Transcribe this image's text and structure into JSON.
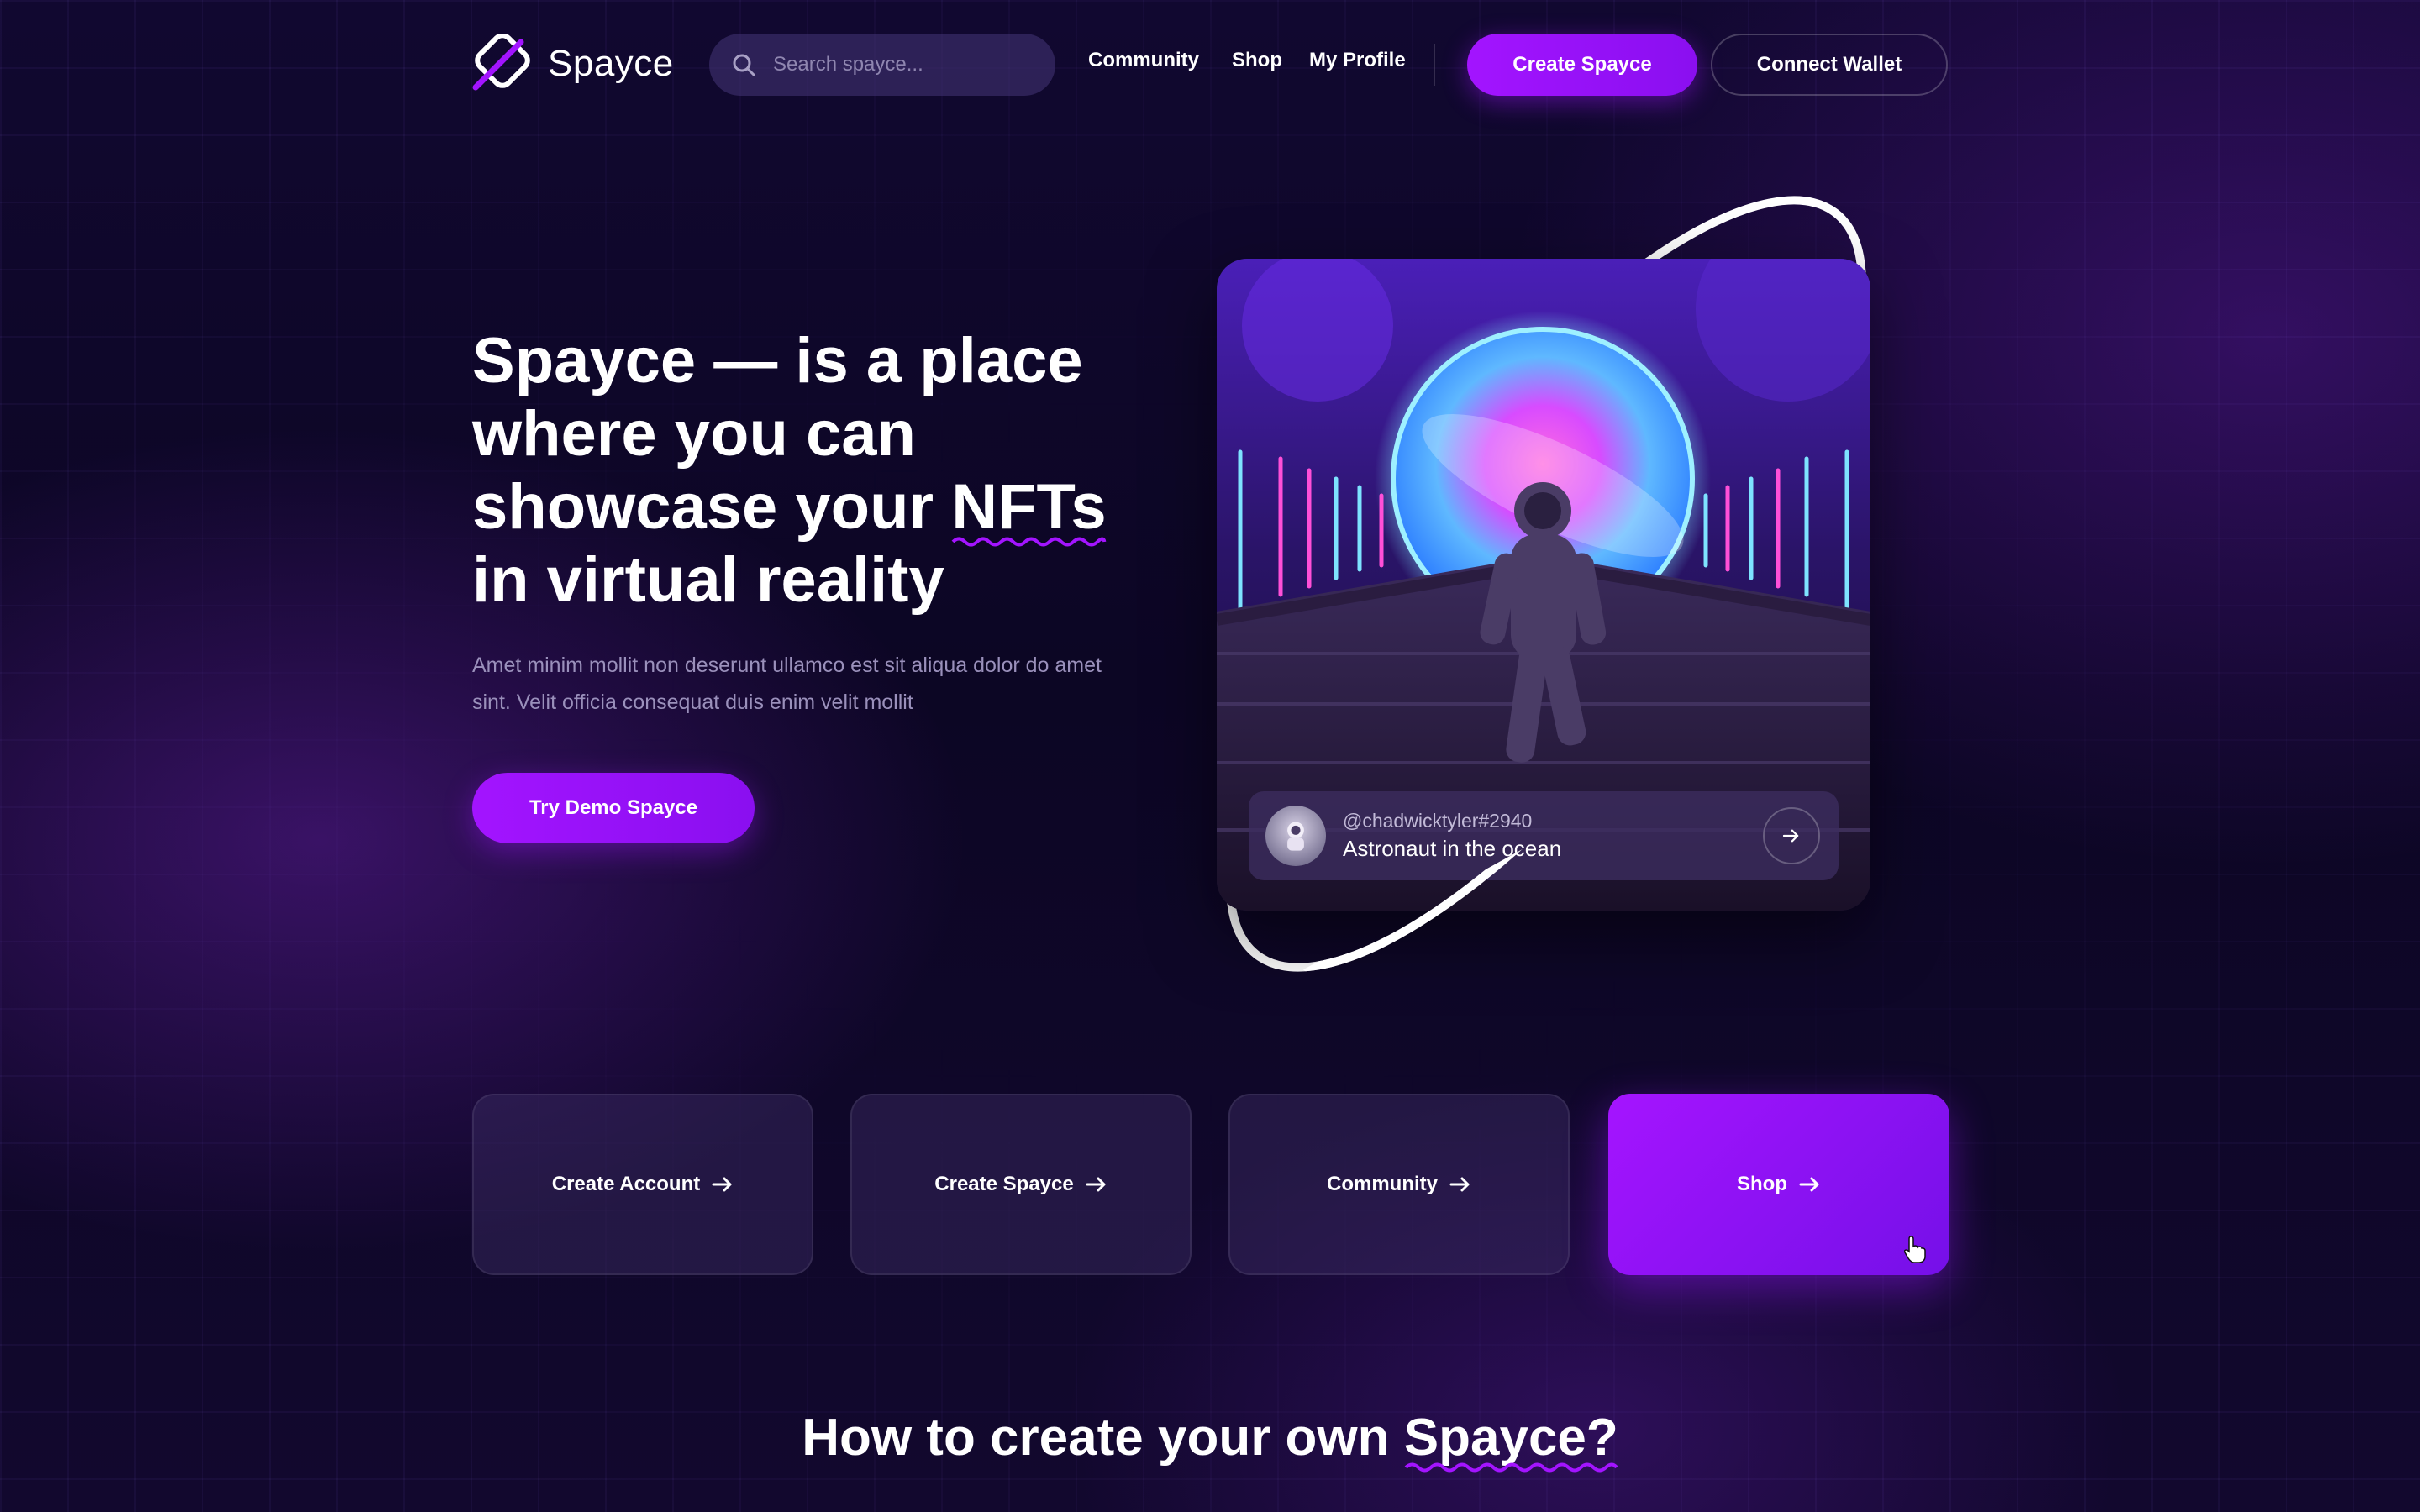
{
  "brand": {
    "name": "Spayce",
    "accent": "#A314FF"
  },
  "search": {
    "placeholder": "Search spayce..."
  },
  "nav": {
    "links": [
      "Community",
      "Shop",
      "My Profile"
    ],
    "create_label": "Create Spayce",
    "wallet_label": "Connect Wallet"
  },
  "hero": {
    "title_lines": [
      "Spayce — is a place",
      "where you can",
      "showcase your ",
      "NFTs",
      "in virtual reality"
    ],
    "subtitle": "Amet minim mollit non deserunt ullamco est sit aliqua dolor do amet sint. Velit officia consequat duis enim velit mollit",
    "cta_label": "Try Demo Spayce"
  },
  "nft": {
    "username": "@chadwicktyler#2940",
    "title": "Astronaut in the ocean"
  },
  "quick_links": [
    "Create Account",
    "Create Spayce",
    "Community",
    "Shop"
  ],
  "active_quick_link": "Shop",
  "section": {
    "title_prefix": "How to create your own ",
    "title_highlight": "Spayce?"
  }
}
